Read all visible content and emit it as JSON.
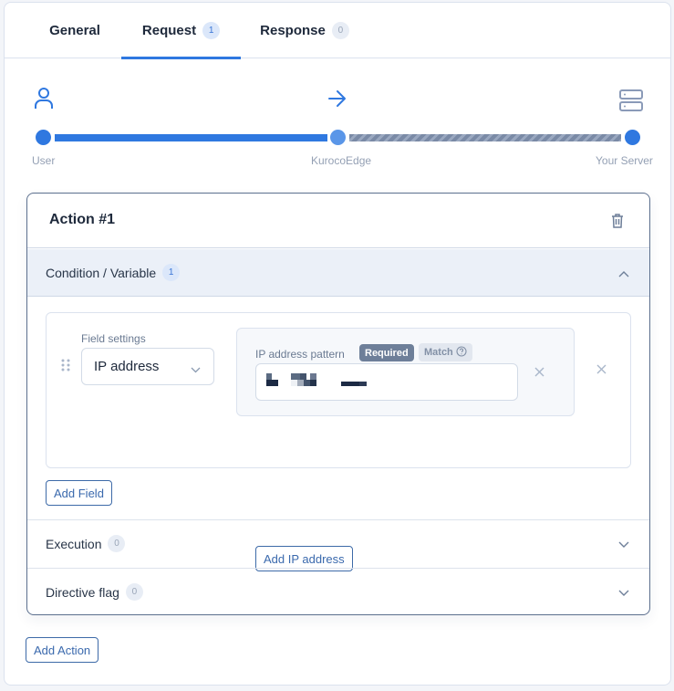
{
  "tabs": [
    {
      "label": "General",
      "count": null,
      "active": false
    },
    {
      "label": "Request",
      "count": "1",
      "active": true
    },
    {
      "label": "Response",
      "count": "0",
      "active": false
    }
  ],
  "flow": {
    "nodes": [
      {
        "label": "User",
        "icon": "user-icon"
      },
      {
        "label": "KurocoEdge",
        "icon": "arrow-right-icon"
      },
      {
        "label": "Your Server",
        "icon": "server-icon"
      }
    ],
    "colors": {
      "active": "#2f78e0",
      "mid": "#5a96e8",
      "inactive": "#7a8aa6"
    }
  },
  "action": {
    "title": "Action #1",
    "sections": {
      "condition": {
        "label": "Condition / Variable",
        "count": "1",
        "expanded": true
      },
      "execution": {
        "label": "Execution",
        "count": "0",
        "expanded": false
      },
      "directive": {
        "label": "Directive flag",
        "count": "0",
        "expanded": false
      }
    },
    "field": {
      "settings_label": "Field settings",
      "selected": "IP address",
      "pattern_label": "IP address pattern",
      "required_badge": "Required",
      "match_badge": "Match",
      "ip_value_redacted": true
    },
    "buttons": {
      "add_ip": "Add IP address",
      "add_field": "Add Field"
    }
  },
  "add_action": "Add Action"
}
